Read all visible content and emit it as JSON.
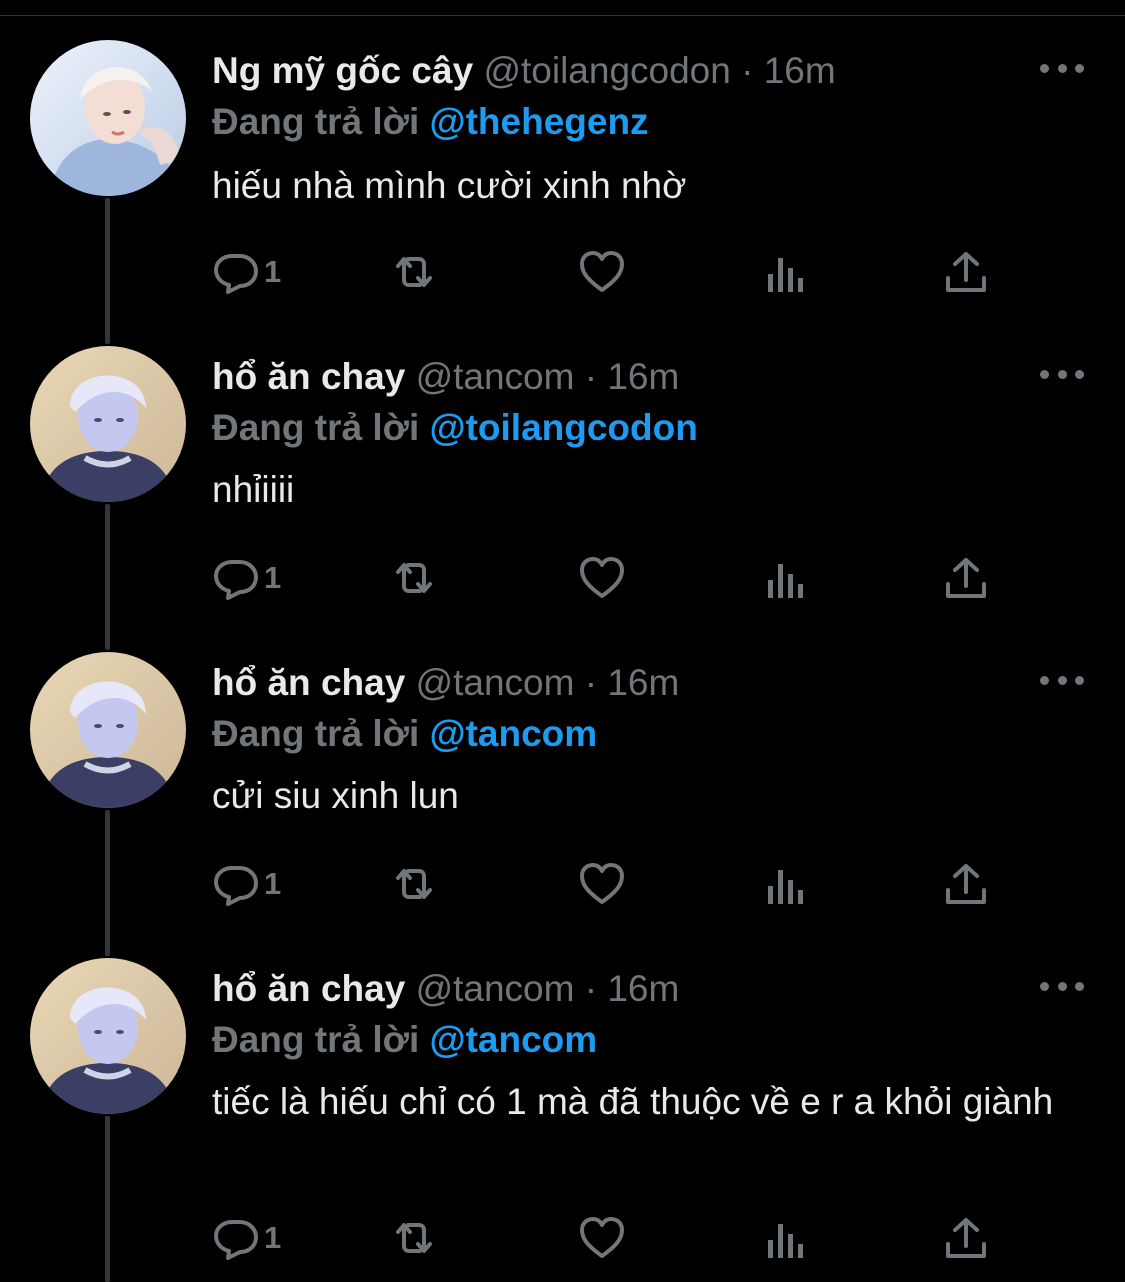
{
  "tweets": [
    {
      "name": "Ng mỹ gốc cây",
      "handle": "@toilangcodon",
      "separator": "·",
      "time": "16m",
      "replying_label": "Đang trả lời",
      "replying_to": "@thehegenz",
      "text": "hiếu nhà mình cười xinh nhờ",
      "reply_count": "1"
    },
    {
      "name": "hổ ăn chay",
      "handle": "@tancom",
      "separator": "·",
      "time": "16m",
      "replying_label": "Đang trả lời",
      "replying_to": "@toilangcodon",
      "text": "nhỉiiii",
      "reply_count": "1"
    },
    {
      "name": "hổ ăn chay",
      "handle": "@tancom",
      "separator": "·",
      "time": "16m",
      "replying_label": "Đang trả lời",
      "replying_to": "@tancom",
      "text": "cửi siu xinh lun",
      "reply_count": "1"
    },
    {
      "name": "hổ ăn chay",
      "handle": "@tancom",
      "separator": "·",
      "time": "16m",
      "replying_label": "Đang trả lời",
      "replying_to": "@tancom",
      "text": "tiếc là hiếu chỉ có 1 mà đã thuộc về e r a khỏi giành",
      "reply_count": "1"
    }
  ],
  "icons": {
    "reply": "reply-icon",
    "retweet": "retweet-icon",
    "like": "heart-icon",
    "views": "analytics-icon",
    "share": "share-icon",
    "more": "more-icon"
  },
  "colors": {
    "background": "#000000",
    "primary_text": "#e7e9ea",
    "secondary_text": "#71767b",
    "accent": "#1d9bf0",
    "thread_line": "#333639"
  }
}
